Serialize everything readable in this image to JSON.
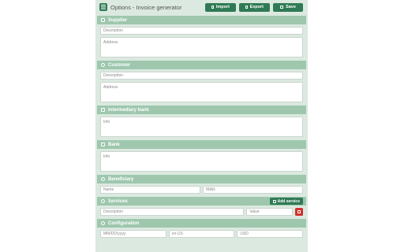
{
  "header": {
    "title": "Options - Invoice generator",
    "import_label": "Import",
    "export_label": "Export",
    "save_label": "Save"
  },
  "supplier": {
    "title": "Supplier",
    "description_placeholder": "Description",
    "address_placeholder": "Address"
  },
  "customer": {
    "title": "Customer",
    "description_placeholder": "Description",
    "address_placeholder": "Address"
  },
  "intermediary_bank": {
    "title": "Intermediary bank",
    "info_placeholder": "Info"
  },
  "bank": {
    "title": "Bank",
    "info_placeholder": "Info"
  },
  "beneficiary": {
    "title": "Beneficiary",
    "name_placeholder": "Name",
    "iban_placeholder": "IBAN"
  },
  "services": {
    "title": "Services",
    "add_label": "Add service",
    "description_placeholder": "Description",
    "value_placeholder": "Value"
  },
  "configuration": {
    "title": "Configuration",
    "date_format_placeholder": "MM/DD/yyyy",
    "locale_placeholder": "en-US",
    "currency_placeholder": "USD"
  },
  "colors": {
    "accent": "#2f7a55",
    "section_header": "#9ec7ae",
    "panel_bg": "#dbe9e0",
    "danger": "#d0312d"
  }
}
